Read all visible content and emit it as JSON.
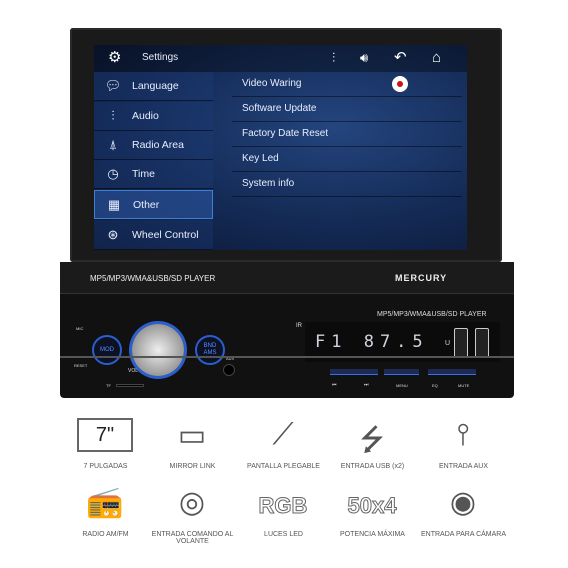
{
  "screen": {
    "title": "Settings",
    "top_icons": [
      "gear-icon",
      "equalizer-icon",
      "volume-icon",
      "back-icon",
      "home-icon"
    ],
    "menu": [
      {
        "label": "Language",
        "icon": "chat-icon",
        "selected": false
      },
      {
        "label": "Audio",
        "icon": "equalizer-icon",
        "selected": false
      },
      {
        "label": "Radio Area",
        "icon": "antenna-icon",
        "selected": false
      },
      {
        "label": "Time",
        "icon": "clock-icon",
        "selected": false
      },
      {
        "label": "Other",
        "icon": "grid-icon",
        "selected": true
      },
      {
        "label": "Wheel Control",
        "icon": "steering-wheel-icon",
        "selected": false
      }
    ],
    "options": [
      "Video Waring",
      "Software Update",
      "Factory Date Reset",
      "Key Led",
      "System info"
    ],
    "video_warning_toggle": true
  },
  "device": {
    "panel_label": "MP5/MP3/WMA&USB/SD PLAYER",
    "brand": "MERCURY",
    "face_label": "MP5/MP3/WMA&USB/SD PLAYER",
    "display": "F1 87.5",
    "mic": "MIC",
    "reset": "RESET",
    "mod": "MOD",
    "vol": "VOL",
    "bnd": "BND AMS",
    "aux": "AUX",
    "ir": "IR",
    "tf": "TF",
    "u": "U",
    "buttons": [
      "⏮",
      "⏭",
      "MENU",
      "EQ",
      "MUTE"
    ],
    "accent": "#2a5fd0"
  },
  "features": [
    {
      "label": "7 PULGADAS",
      "icon": "screen-7-icon",
      "glyph": "7\""
    },
    {
      "label": "MIRROR LINK",
      "icon": "mirror-link-icon",
      "glyph": "▭"
    },
    {
      "label": "PANTALLA PLEGABLE",
      "icon": "folding-screen-icon",
      "glyph": "⟋"
    },
    {
      "label": "ENTRADA USB (x2)",
      "icon": "usb-icon",
      "glyph": "⭍"
    },
    {
      "label": "ENTRADA AUX",
      "icon": "aux-jack-icon",
      "glyph": "⫯"
    },
    {
      "label": "RADIO AM/FM",
      "icon": "radio-icon",
      "glyph": "📻"
    },
    {
      "label": "ENTRADA COMANDO AL VOLANTE",
      "icon": "steering-wheel-icon",
      "glyph": "◎"
    },
    {
      "label": "LUCES LED",
      "icon": "rgb-icon",
      "glyph": "RGB"
    },
    {
      "label": "POTENCIA MÁXIMA",
      "icon": "power-50x4-icon",
      "glyph": "50x4"
    },
    {
      "label": "ENTRADA PARA CÁMARA",
      "icon": "camera-icon",
      "glyph": "◉"
    }
  ]
}
